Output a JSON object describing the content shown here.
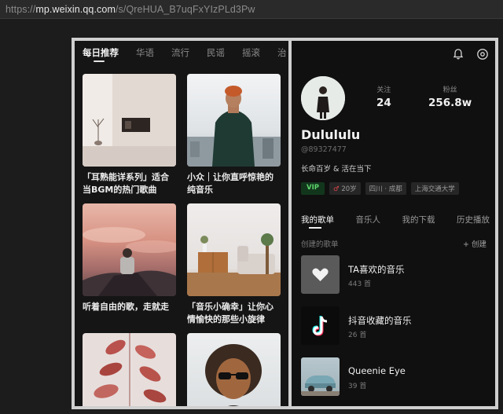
{
  "browser": {
    "url_scheme": "https://",
    "url_host": "mp.weixin.qq.com",
    "url_path": "/s/QreHUA_B7uqFxYIzPLd3Pw"
  },
  "discover": {
    "tabs": [
      "每日推荐",
      "华语",
      "流行",
      "民谣",
      "摇滚",
      "治"
    ],
    "active_tab": 0,
    "cards": [
      {
        "title": "「耳熟能详系列」适合当BGM的热门歌曲"
      },
      {
        "title": "小众｜让你直呼惊艳的纯音乐"
      },
      {
        "title": "听着自由的歌，走就走"
      },
      {
        "title": "「音乐小确幸」让你心情愉快的那些小旋律"
      }
    ]
  },
  "profile": {
    "icons": [
      "bell-icon",
      "settings-icon"
    ],
    "following_label": "关注",
    "following_count": "24",
    "fans_label": "粉丝",
    "fans_count": "256.8w",
    "username": "Dulululu",
    "user_id": "@89327477",
    "bio": "长命百岁 & 活在当下",
    "tags": {
      "vip": "VIP",
      "age": "20岁",
      "location": "四川 · 成都",
      "school": "上海交通大学"
    },
    "tabs": [
      "我的歌单",
      "音乐人",
      "我的下载",
      "历史播放"
    ],
    "active_tab": 0,
    "section_title": "创建的歌单",
    "create_label": "+ 创建",
    "playlists": [
      {
        "name": "TA喜欢的音乐",
        "count": "443 首"
      },
      {
        "name": "抖音收藏的音乐",
        "count": "26 首"
      },
      {
        "name": "Queenie Eye",
        "count": "39 首"
      }
    ]
  },
  "colors": {
    "background": "#1c1c1c",
    "panel": "#151515",
    "vip_green": "#5ed46b",
    "accent_red": "#e0444a"
  }
}
